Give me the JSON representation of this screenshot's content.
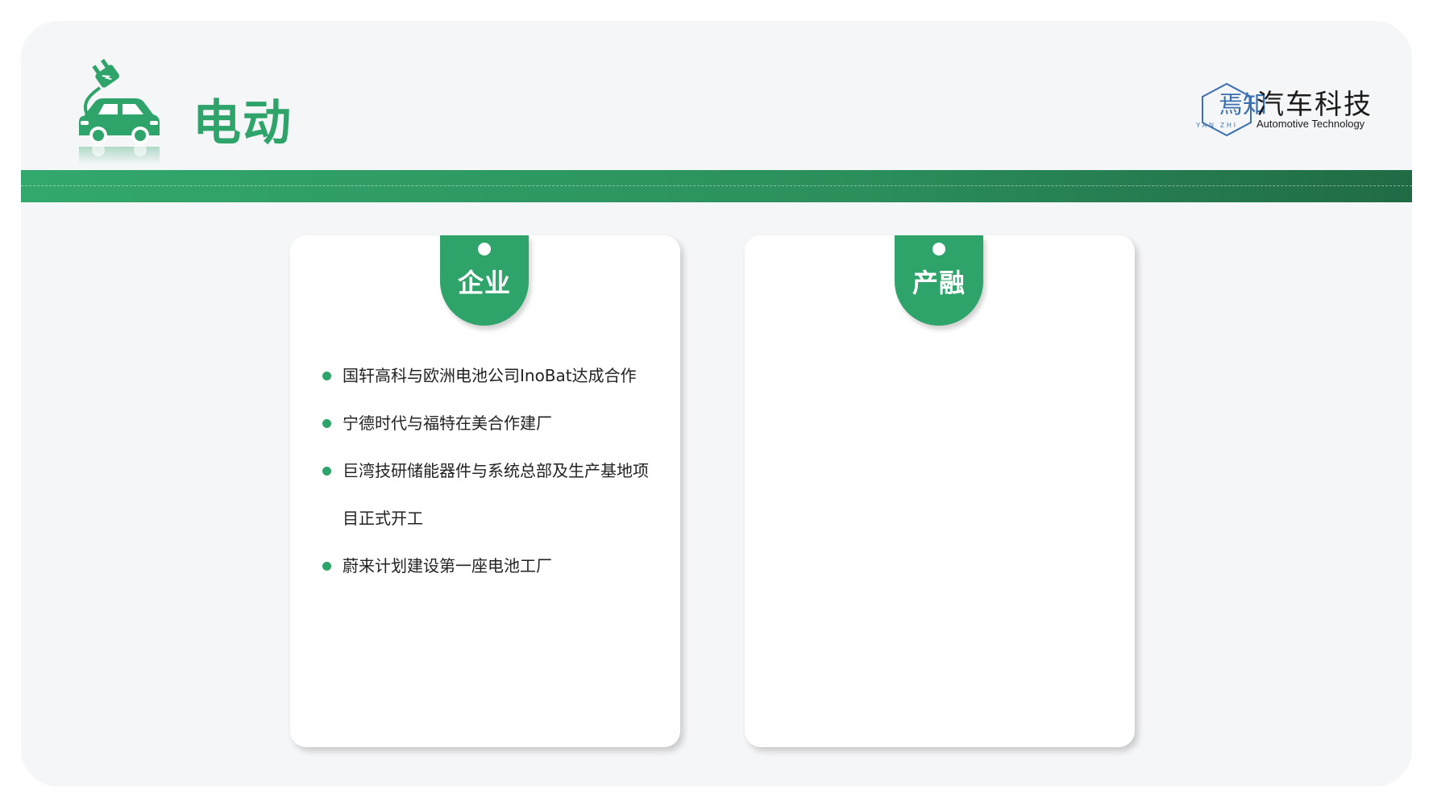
{
  "header": {
    "title": "电动"
  },
  "logo": {
    "mark_text": "焉知",
    "mark_subtext": "YAN ZHI",
    "name_cn": "汽车科技",
    "name_en": "Automotive Technology"
  },
  "cards": [
    {
      "tab_label": "企业",
      "items": [
        {
          "text": "国轩高科与欧洲电池公司InoBat达成合作"
        },
        {
          "text": "宁德时代与福特在美合作建厂"
        },
        {
          "text": "巨湾技研储能器件与系统总部及生产基地项目正式开工"
        },
        {
          "text": "蔚来计划建设第一座电池工厂"
        }
      ]
    },
    {
      "tab_label": "产融",
      "items": []
    }
  ],
  "colors": {
    "accent_green": "#2ea36a",
    "banner_dark": "#206b45",
    "background": "#f5f6f8"
  },
  "icons": [
    "ev-car-plug-icon",
    "yanzhi-logo-icon"
  ]
}
